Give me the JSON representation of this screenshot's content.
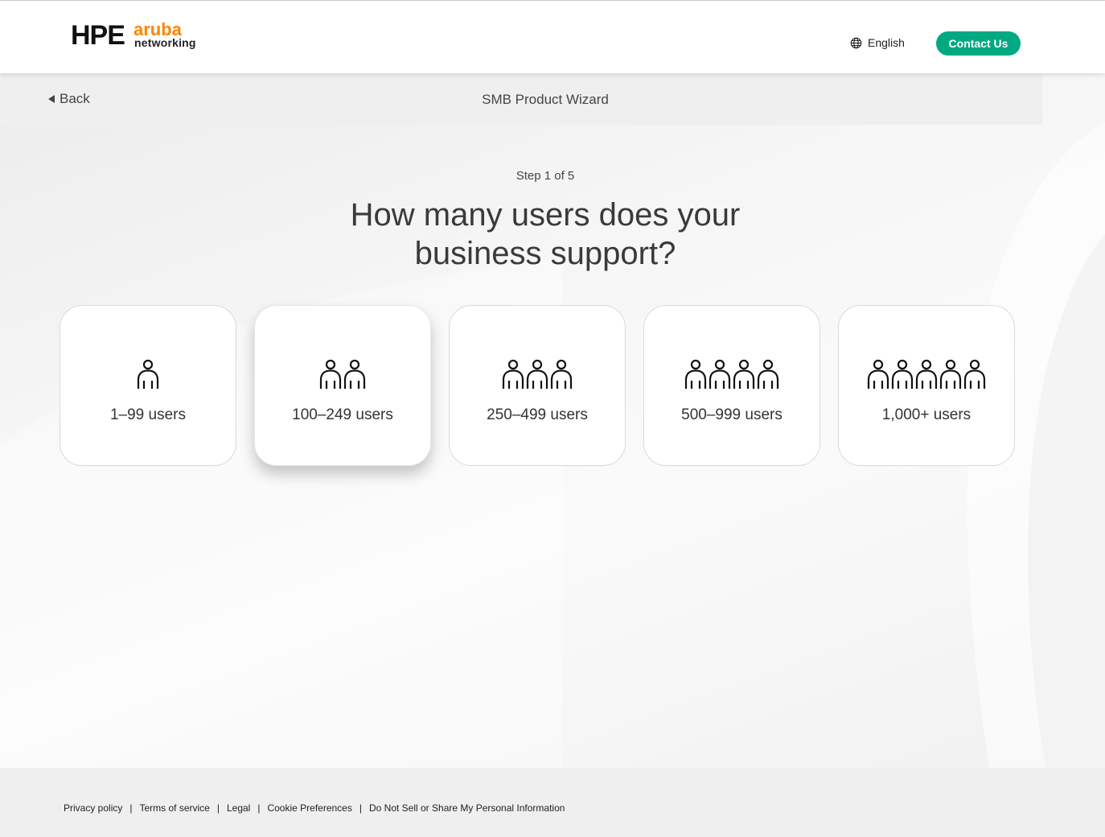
{
  "header": {
    "logo_text_hpe": "HPE",
    "logo_text_aruba": "aruba",
    "logo_text_networking": "networking",
    "language": "English",
    "contact_label": "Contact Us"
  },
  "subbar": {
    "back_label": "Back",
    "title": "SMB Product Wizard"
  },
  "wizard": {
    "step": "Step 1 of 5",
    "question": "How many users does your business support?",
    "options": [
      {
        "label": "1–99 users",
        "people": 1
      },
      {
        "label": "100–249 users",
        "people": 2
      },
      {
        "label": "250–499 users",
        "people": 3
      },
      {
        "label": "500–999 users",
        "people": 4
      },
      {
        "label": "1,000+ users",
        "people": 5
      }
    ]
  },
  "footer": {
    "links": [
      "Privacy policy",
      "Terms of service",
      "Legal",
      "Cookie Preferences",
      "Do Not Sell or Share My Personal Information"
    ]
  },
  "colors": {
    "accent": "#01a982",
    "brand_orange": "#ff8300"
  },
  "icons": [
    "globe-icon",
    "back-arrow-icon",
    "person-icon"
  ]
}
